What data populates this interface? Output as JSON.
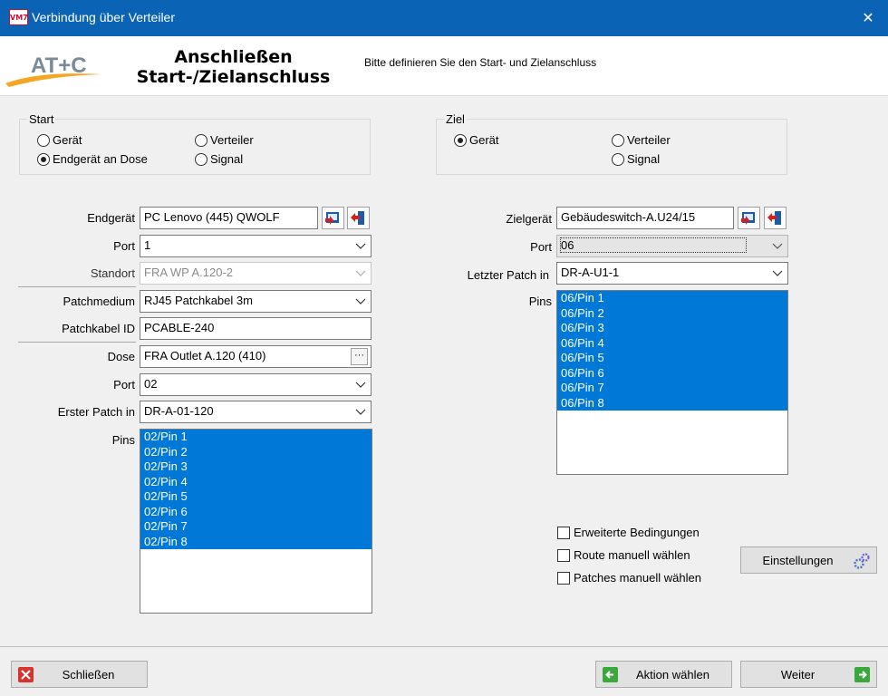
{
  "window": {
    "icon_text": "VM7",
    "title": "Verbindung über Verteiler",
    "close": "✕"
  },
  "header": {
    "logo_text": "AT+C",
    "title_line1": "Anschließen",
    "title_line2": "Start-/Zielanschluss",
    "description": "Bitte definieren Sie den Start- und Zielanschluss"
  },
  "start": {
    "legend": "Start",
    "radios": [
      "Gerät",
      "Verteiler",
      "Endgerät an Dose",
      "Signal"
    ],
    "selected": "Endgerät an Dose"
  },
  "ziel": {
    "legend": "Ziel",
    "radios": [
      "Gerät",
      "Verteiler",
      "Signal"
    ],
    "selected": "Gerät"
  },
  "left_form": {
    "endgeraet_label": "Endgerät",
    "endgeraet_value": "PC Lenovo (445) QWOLF",
    "port_label": "Port",
    "port_value": "1",
    "standort_label": "Standort",
    "standort_value": "FRA WP A.120-2",
    "patchmedium_label": "Patchmedium",
    "patchmedium_value": "RJ45 Patchkabel 3m",
    "patchkabel_label": "Patchkabel ID",
    "patchkabel_value": "PCABLE-240",
    "dose_label": "Dose",
    "dose_value": "FRA Outlet A.120 (410)",
    "dose_btn": "···",
    "port2_label": "Port",
    "port2_value": "02",
    "erster_label": "Erster Patch in",
    "erster_value": "DR-A-01-120",
    "pins_label": "Pins",
    "pins": [
      "02/Pin 1",
      "02/Pin 2",
      "02/Pin 3",
      "02/Pin 4",
      "02/Pin 5",
      "02/Pin 6",
      "02/Pin 7",
      "02/Pin 8"
    ]
  },
  "right_form": {
    "zielgeraet_label": "Zielgerät",
    "zielgeraet_value": "Gebäudeswitch-A.U24/15",
    "port_label": "Port",
    "port_value": "06",
    "letzter_label": "Letzter Patch in",
    "letzter_value": "DR-A-U1-1",
    "pins_label": "Pins",
    "pins": [
      "06/Pin 1",
      "06/Pin 2",
      "06/Pin 3",
      "06/Pin 4",
      "06/Pin 5",
      "06/Pin 6",
      "06/Pin 7",
      "06/Pin 8"
    ]
  },
  "options": {
    "erweitert": "Erweiterte Bedingungen",
    "route": "Route manuell wählen",
    "patches": "Patches manuell wählen",
    "einstellungen": "Einstellungen"
  },
  "footer": {
    "schliessen": "Schließen",
    "aktion": "Aktion wählen",
    "weiter": "Weiter"
  },
  "colors": {
    "titlebar": "#0a63b4",
    "selection": "#0078d7",
    "logo_orange": "#f5a623"
  }
}
